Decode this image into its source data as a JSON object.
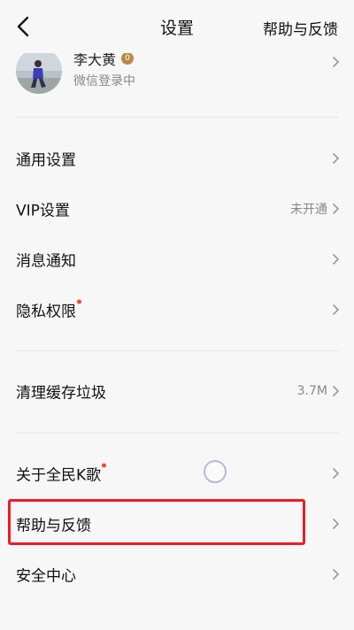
{
  "header": {
    "title": "设置",
    "right_link": "帮助与反馈"
  },
  "profile": {
    "name": "李大黄",
    "badge": "0",
    "status": "微信登录中"
  },
  "groups": [
    {
      "items": [
        {
          "label": "通用设置",
          "value": ""
        },
        {
          "label": "VIP设置",
          "value": "未开通"
        },
        {
          "label": "消息通知",
          "value": ""
        },
        {
          "label": "隐私权限",
          "value": "",
          "red_dot": true
        }
      ]
    },
    {
      "items": [
        {
          "label": "清理缓存垃圾",
          "value": "3.7M"
        }
      ]
    },
    {
      "items": [
        {
          "label": "关于全民K歌",
          "value": "",
          "red_dot": true
        },
        {
          "label": "帮助与反馈",
          "value": "",
          "highlighted": true
        },
        {
          "label": "安全中心",
          "value": ""
        }
      ]
    }
  ],
  "colors": {
    "background": "#f7f7f7",
    "text": "#111111",
    "secondary_text": "#888888",
    "red_dot": "#f04a2a",
    "highlight_border": "#ee1b24"
  },
  "icons": [
    "back-arrow-icon",
    "chevron-right-icon",
    "user-avatar",
    "level-badge-icon",
    "loading-ring-icon"
  ]
}
